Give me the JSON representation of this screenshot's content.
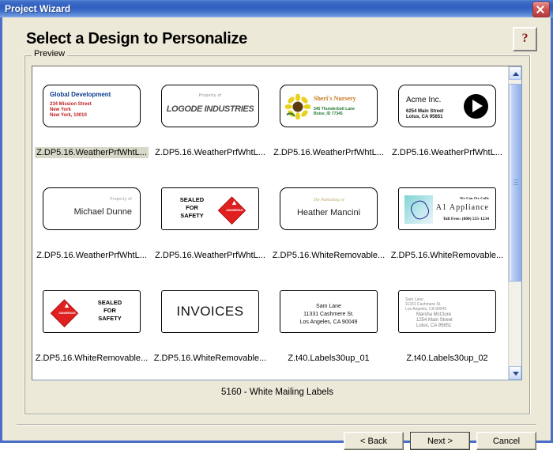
{
  "window": {
    "title": "Project Wizard",
    "close_icon": "close-icon"
  },
  "header": {
    "page_title": "Select a Design to Personalize",
    "help_icon": "?"
  },
  "preview": {
    "legend": "Preview",
    "status": "5160 - White Mailing Labels",
    "scroll_up_icon": "chevron-up-icon",
    "scroll_down_icon": "chevron-down-icon"
  },
  "designs": [
    {
      "caption": "Z.DP5.16.WeatherPrfWhtL...",
      "selected": true,
      "kind": "global-development",
      "title": "Global Development",
      "address": "234 Mission Street\nNew York\nNew York, 10010"
    },
    {
      "caption": "Z.DP5.16.WeatherPrfWhtL...",
      "selected": false,
      "kind": "logode-industries",
      "property_of": "Property of",
      "logo_text": "LOGODE INDUSTRIES"
    },
    {
      "caption": "Z.DP5.16.WeatherPrfWhtL...",
      "selected": false,
      "kind": "sheris-nursery",
      "title": "Sheri's Nursery",
      "address": "345 Thunderbolt Lane\nBoise, ID 77345",
      "image": "sunflower-image"
    },
    {
      "caption": "Z.DP5.16.WeatherPrfWhtL...",
      "selected": false,
      "kind": "acme-inc",
      "title": "Acme Inc.",
      "address": "6254 Main Street\nLotus, CA 95651",
      "image": "play-circle-icon"
    },
    {
      "caption": "Z.DP5.16.WeatherPrfWhtL...",
      "selected": false,
      "kind": "michael-dunne",
      "property_of": "Property of",
      "name": "Michael Dunne"
    },
    {
      "caption": "Z.DP5.16.WeatherPrfWhtL...",
      "selected": false,
      "kind": "sealed-for-safety-right",
      "text": "SEALED\nFOR\nSAFETY",
      "badge_word": "DANGEROUS",
      "image": "hazard-diamond-icon"
    },
    {
      "caption": "Z.DP5.16.WhiteRemovable...",
      "selected": false,
      "kind": "heather-mancini",
      "script_text": "The Publishing of",
      "name": "Heather Mancini"
    },
    {
      "caption": "Z.DP5.16.WhiteRemovable...",
      "selected": false,
      "kind": "a1-appliance",
      "tagline": "We Can Fix Calls",
      "title": "A1 Appliance",
      "toll_free": "Toll Free: (800) 555-1234",
      "image": "appliance-icon"
    },
    {
      "caption": "Z.DP5.16.WhiteRemovable...",
      "selected": false,
      "kind": "sealed-for-safety-left",
      "text": "SEALED\nFOR\nSAFETY",
      "badge_word": "DANGEROUS",
      "image": "hazard-diamond-icon"
    },
    {
      "caption": "Z.DP5.16.WhiteRemovable...",
      "selected": false,
      "kind": "invoices",
      "text": "INVOICES"
    },
    {
      "caption": "Z.t40.Labels30up_01",
      "selected": false,
      "kind": "sam-lane",
      "text": "Sam Lane\n11331 Cashmere St.\nLos Angeles, CA 90049"
    },
    {
      "caption": "Z.t40.Labels30up_02",
      "selected": false,
      "kind": "return-address",
      "from": "Sam Lane\n11331 Cashmere St.\nLos Angeles, CA 90049",
      "to": "Marsha McClure\n1254 Main Street\nLotus, CA 95651"
    }
  ],
  "footer": {
    "back_label": "< Back",
    "next_label": "Next >",
    "cancel_label": "Cancel"
  }
}
